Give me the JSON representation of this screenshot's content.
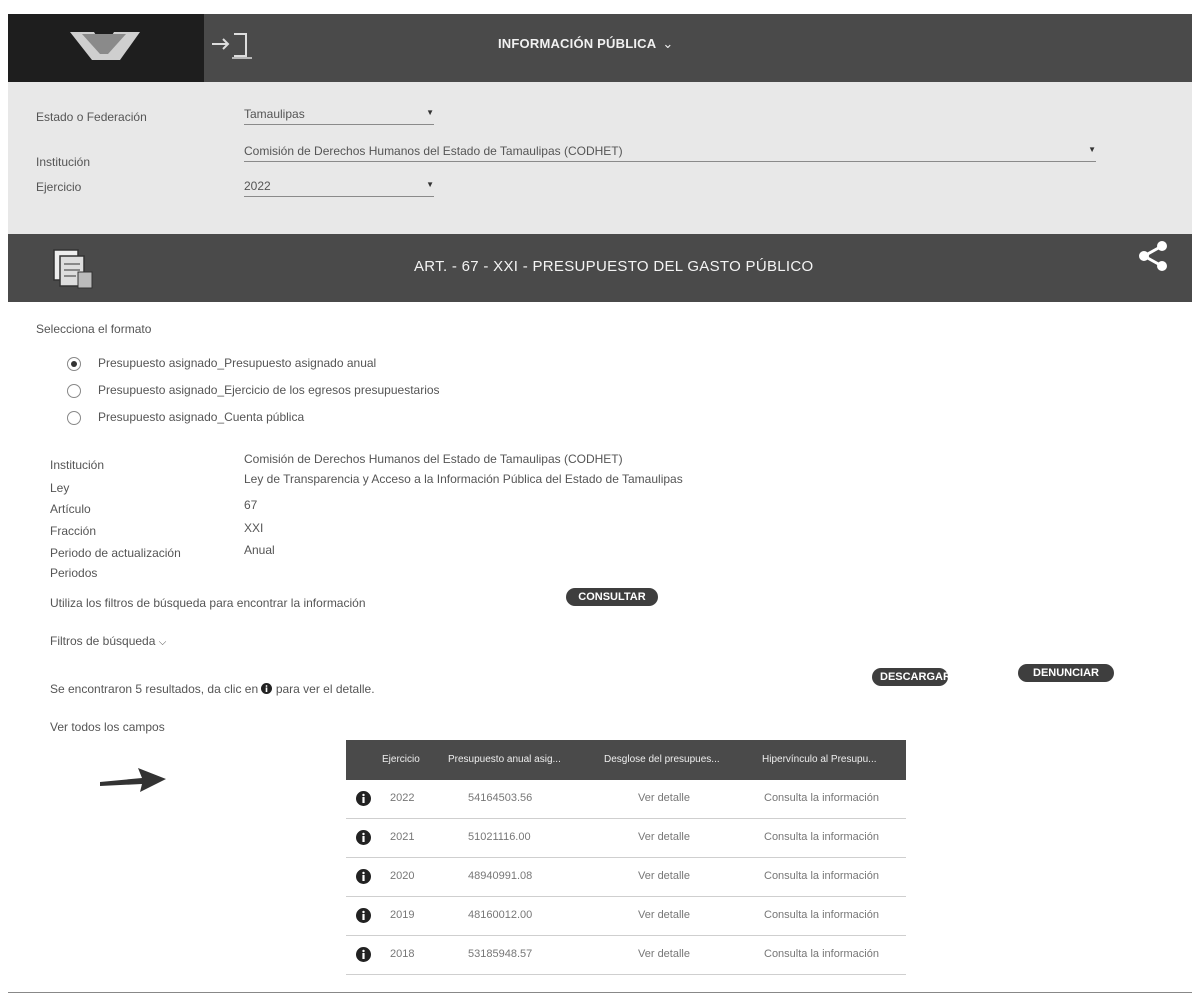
{
  "header": {
    "title": "INFORMACIÓN PÚBLICA",
    "title_chevron": "⌄",
    "icons": [
      "logo-icon",
      "login-icon"
    ]
  },
  "filters": {
    "estado": {
      "label": "Estado o Federación",
      "value": "Tamaulipas"
    },
    "institucion": {
      "label": "Institución",
      "value": "Comisión de Derechos Humanos del Estado de Tamaulipas (CODHET)"
    },
    "ejercicio": {
      "label": "Ejercicio",
      "value": "2022"
    }
  },
  "section": {
    "title": "ART. - 67 - XXI - PRESUPUESTO DEL GASTO PÚBLICO",
    "icons": [
      "document-stack-icon",
      "share-icon"
    ]
  },
  "format": {
    "prompt": "Selecciona el formato",
    "options": [
      {
        "label": "Presupuesto asignado_Presupuesto asignado anual",
        "checked": true
      },
      {
        "label": "Presupuesto asignado_Ejercicio de los egresos presupuestarios",
        "checked": false
      },
      {
        "label": "Presupuesto asignado_Cuenta pública",
        "checked": false
      }
    ]
  },
  "details": [
    {
      "label": "Institución",
      "value": "Comisión de Derechos Humanos del Estado de Tamaulipas (CODHET)"
    },
    {
      "label": "Ley",
      "value": "Ley de Transparencia y Acceso a la Información Pública del Estado de Tamaulipas"
    },
    {
      "label": "Artículo",
      "value": "67"
    },
    {
      "label": "Fracción",
      "value": "XXI"
    },
    {
      "label": "Periodo de actualización",
      "value": "Anual"
    }
  ],
  "periods_label": "Periodos",
  "query_text": "Utiliza los filtros de búsqueda para encontrar la información",
  "consultar_label": "CONSULTAR",
  "filtros_label": "Filtros de búsqueda",
  "results_text": "Se encontraron 5 resultados, da clic en",
  "results_text_end": "para ver el detalle.",
  "columns_label": "Ver todos los campos",
  "descargar_label": "DESCARGAR",
  "denunciar_label": "DENUNCIAR",
  "table": {
    "headers": [
      "Ejercicio",
      "Presupuesto anual asig...",
      "Desglose del presupues...",
      "Hipervínculo al Presupu..."
    ],
    "rows": [
      {
        "ejercicio": "2022",
        "presupuesto": "54164503.56",
        "desglose": "Ver detalle",
        "hipervinculo": "Consulta la información"
      },
      {
        "ejercicio": "2021",
        "presupuesto": "51021116.00",
        "desglose": "Ver detalle",
        "hipervinculo": "Consulta la información"
      },
      {
        "ejercicio": "2020",
        "presupuesto": "48940991.08",
        "desglose": "Ver detalle",
        "hipervinculo": "Consulta la información"
      },
      {
        "ejercicio": "2019",
        "presupuesto": "48160012.00",
        "desglose": "Ver detalle",
        "hipervinculo": "Consulta la información"
      },
      {
        "ejercicio": "2018",
        "presupuesto": "53185948.57",
        "desglose": "Ver detalle",
        "hipervinculo": "Consulta la información"
      }
    ]
  }
}
